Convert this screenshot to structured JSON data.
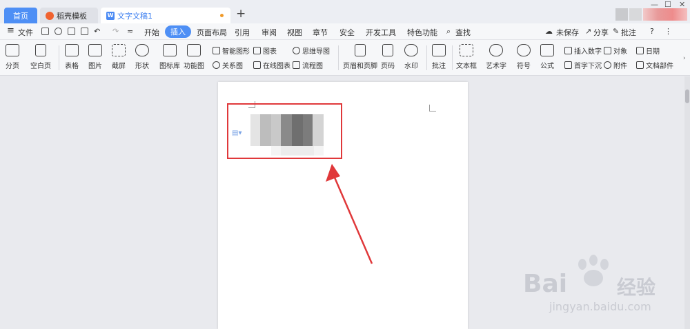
{
  "tabs": {
    "home": "首页",
    "templates": "稻壳模板",
    "document": "文字文稿1",
    "new_tab": "+"
  },
  "window_controls": [
    "—",
    "☐",
    "✕"
  ],
  "menubar": {
    "file": "文件",
    "tabs": [
      "开始",
      "插入",
      "页面布局",
      "引用",
      "审阅",
      "视图",
      "章节",
      "安全",
      "开发工具",
      "特色功能"
    ],
    "active_tab": "插入",
    "search": "查找",
    "unsaved": "未保存",
    "share": "分享",
    "comment": "批注",
    "help": "?",
    "more": "⋮"
  },
  "ribbon": {
    "large": [
      {
        "label": "分页"
      },
      {
        "label": "空白页"
      },
      {
        "label": "表格"
      },
      {
        "label": "图片"
      },
      {
        "label": "截屏"
      },
      {
        "label": "形状"
      },
      {
        "label": "图标库"
      },
      {
        "label": "功能图"
      },
      {
        "label": "页眉和页脚"
      },
      {
        "label": "页码"
      },
      {
        "label": "水印"
      },
      {
        "label": "批注"
      },
      {
        "label": "文本框"
      },
      {
        "label": "艺术字"
      },
      {
        "label": "符号"
      },
      {
        "label": "公式"
      }
    ],
    "small": {
      "smartart": "智能图形",
      "chart": "图表",
      "mindmap": "思维导图",
      "relation": "关系图",
      "online_chart": "在线图表",
      "flowchart": "流程图",
      "insert_number": "插入数字",
      "object": "对象",
      "date": "日期",
      "dropcap": "首字下沉",
      "attachment": "附件",
      "doc_parts": "文档部件"
    }
  },
  "watermark": {
    "brand": "Bai",
    "brand2": "经验",
    "url": "jingyan.baidu.com"
  },
  "colors": {
    "accent": "#4e8ff5",
    "highlight_box": "#e0383a",
    "arrow": "#e0383a"
  }
}
